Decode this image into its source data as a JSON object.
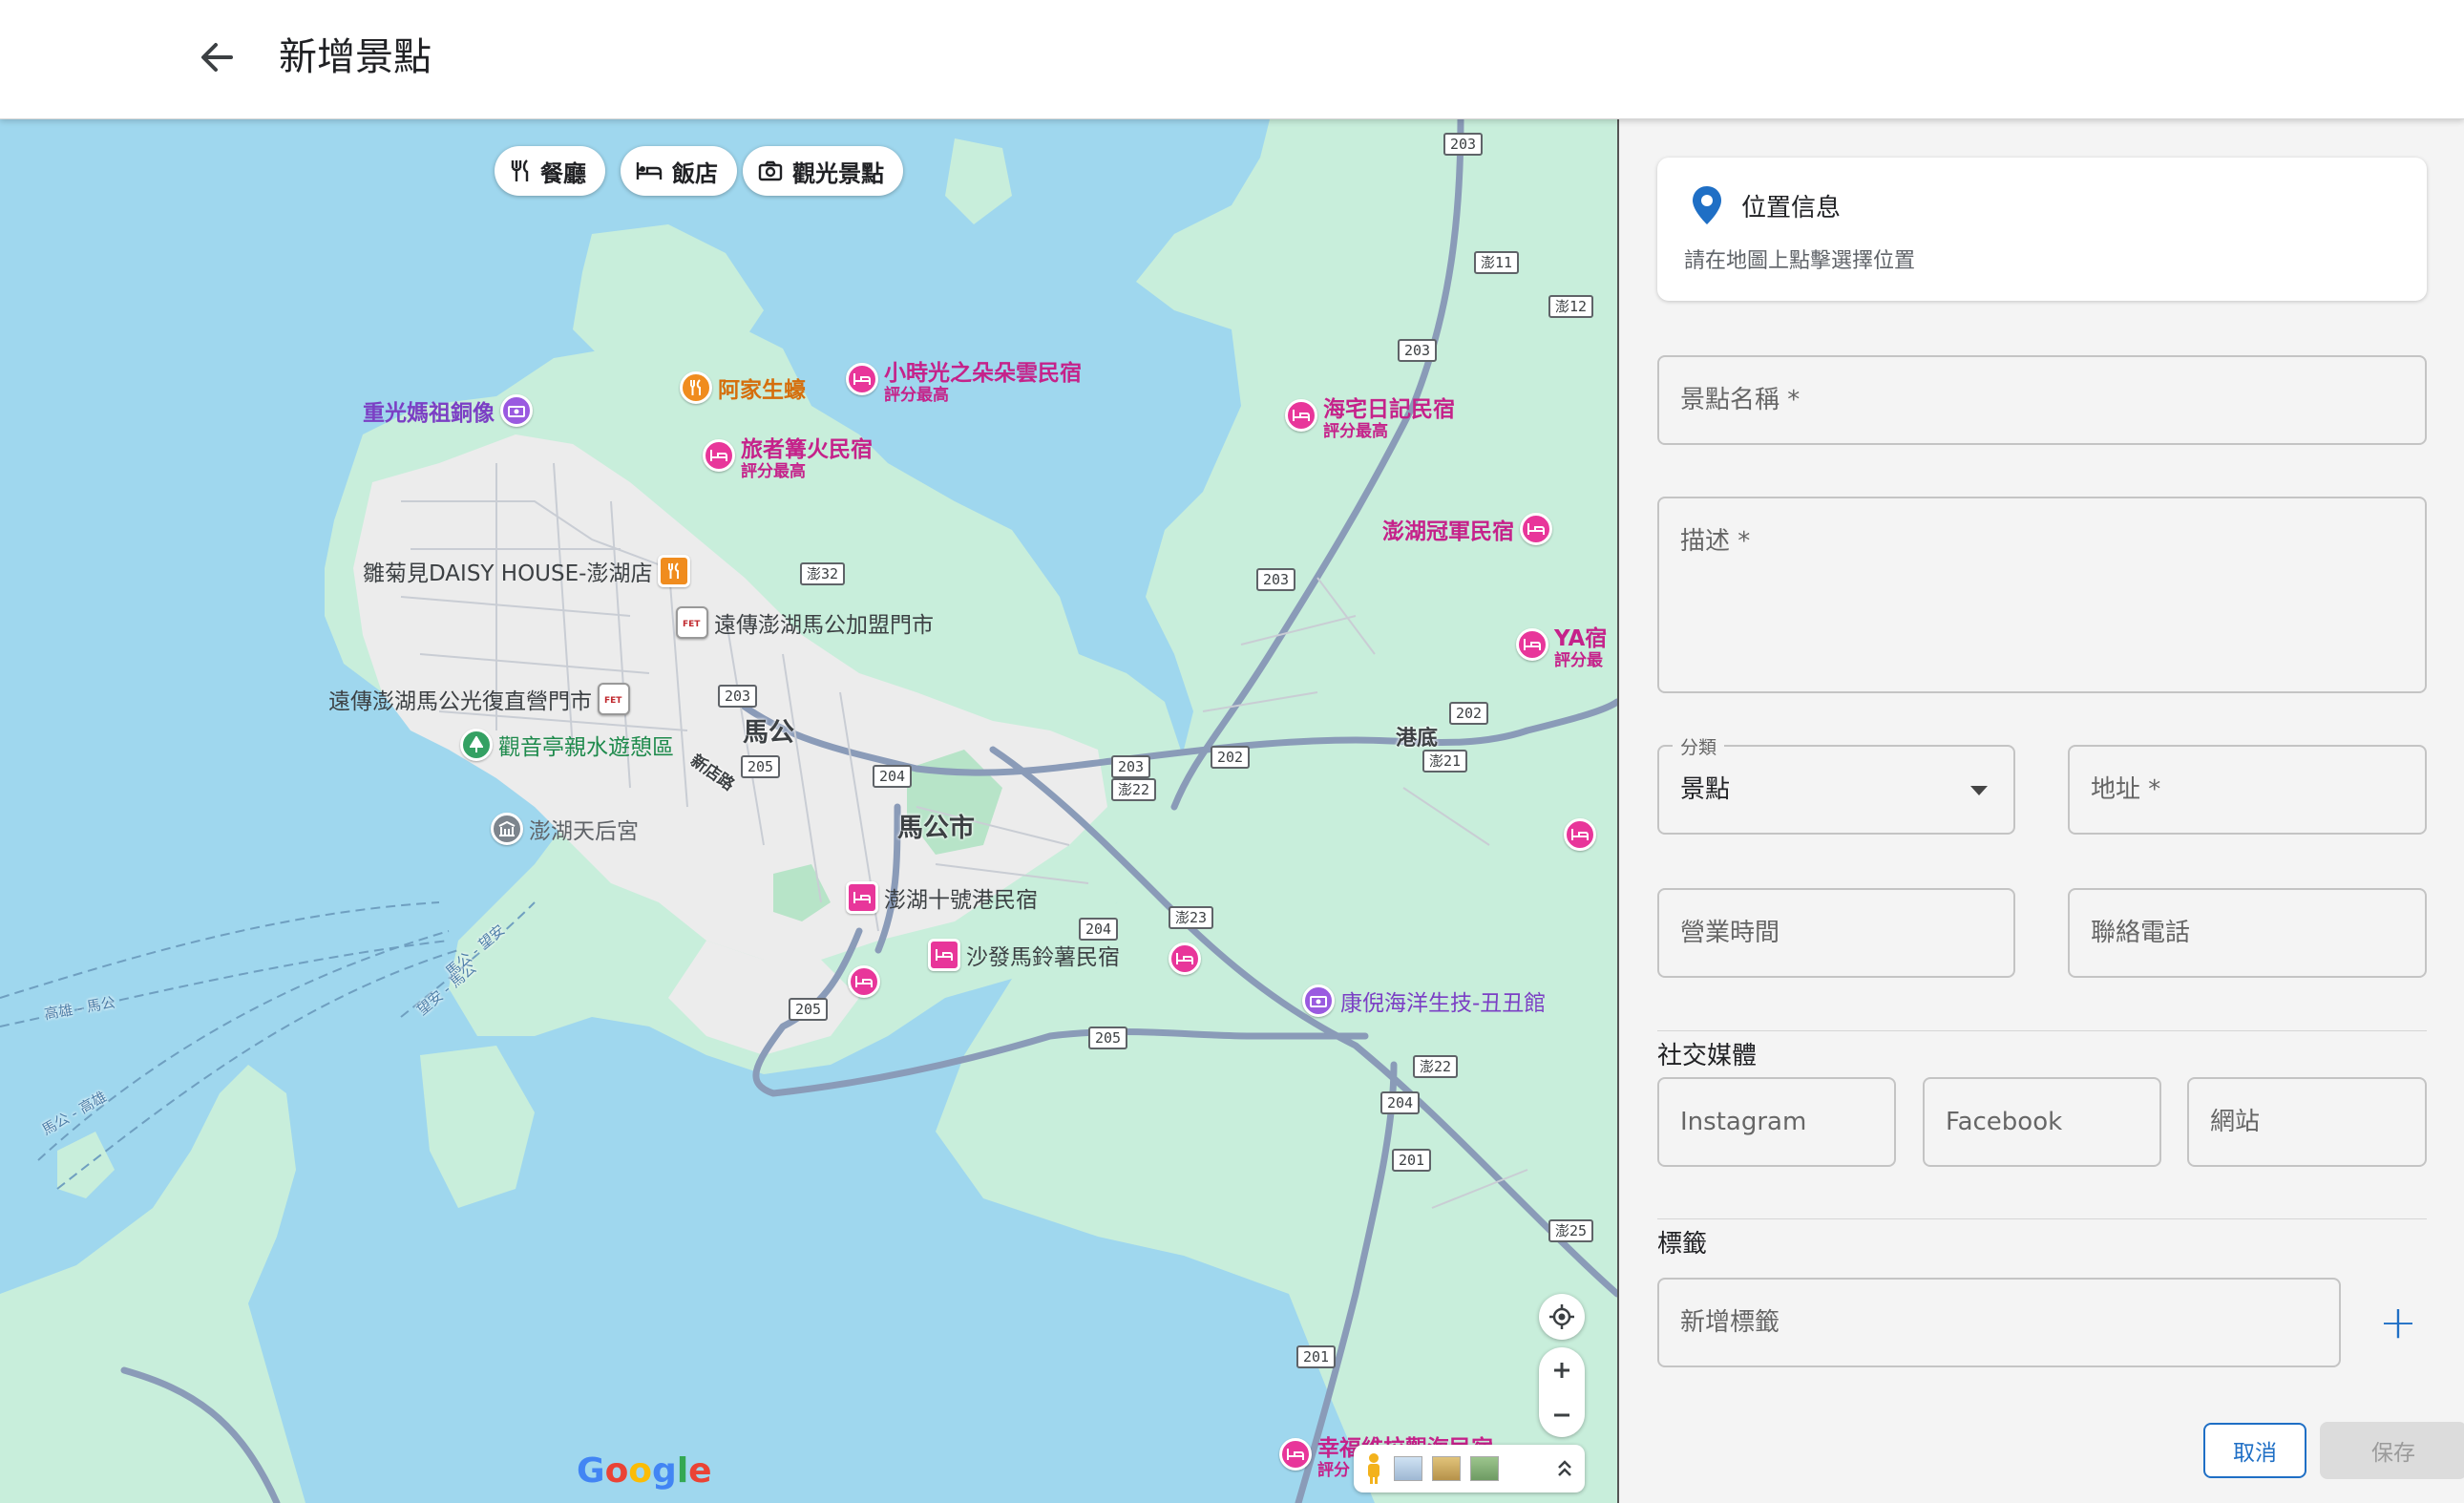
{
  "header": {
    "title": "新增景點"
  },
  "map": {
    "chips": [
      {
        "label": "餐廳",
        "icon": "fork-knife-icon"
      },
      {
        "label": "飯店",
        "icon": "bed-icon"
      },
      {
        "label": "觀光景點",
        "icon": "camera-icon"
      }
    ],
    "pois": {
      "p1": "小時光之朵朵雲民宿",
      "p1s": "評分最高",
      "p2": "阿家生蠔",
      "p3": "重光媽祖銅像",
      "p4": "旅者篝火民宿",
      "p4s": "評分最高",
      "p5": "海宅日記民宿",
      "p5s": "評分最高",
      "p6": "澎湖冠軍民宿",
      "p7": "雛菊見DAISY HOUSE-澎湖店",
      "p8": "遠傳澎湖馬公加盟門市",
      "p9": "YA宿",
      "p9s": "評分最",
      "p10": "遠傳澎湖馬公光復直營門市",
      "p11": "觀音亭親水遊憩區",
      "p12": "澎湖天后宮",
      "p13": "澎湖十號港民宿",
      "p14": "沙發馬鈴薯民宿",
      "p15": "康倪海洋生技-丑丑館",
      "p16": "幸福維拉觀海民宿",
      "p16s": "評分"
    },
    "places": {
      "magong": "馬公",
      "magong_city": "馬公市",
      "gangdi": "港底",
      "xindian_rd": "新店路"
    },
    "shields": [
      "203",
      "澎11",
      "澎12",
      "203",
      "澎32",
      "203",
      "203",
      "202",
      "202",
      "澎21",
      "205",
      "204",
      "203",
      "澎22",
      "202",
      "204",
      "澎23",
      "205",
      "205",
      "澎22",
      "204",
      "201",
      "澎25",
      "201"
    ],
    "ferry_routes": [
      "高雄 - 馬公",
      "馬公 - 高雄",
      "望安 - 馬公",
      "馬公 - 望安"
    ],
    "google_logo": "Google",
    "colors": {
      "water": "#9fd7ee",
      "land": "#c8eedb",
      "urban": "#eeeeee",
      "road": "#8a9bb8"
    }
  },
  "form": {
    "location": {
      "title": "位置信息",
      "hint": "請在地圖上點擊選擇位置"
    },
    "name_placeholder": "景點名稱 *",
    "desc_placeholder": "描述 *",
    "category": {
      "label": "分類",
      "value": "景點"
    },
    "address_placeholder": "地址 *",
    "hours_placeholder": "營業時間",
    "phone_placeholder": "聯絡電話",
    "social_title": "社交媒體",
    "instagram_placeholder": "Instagram",
    "facebook_placeholder": "Facebook",
    "website_placeholder": "網站",
    "tags_title": "標籤",
    "tag_placeholder": "新增標籤",
    "add_symbol": "+",
    "cancel_label": "取消",
    "save_label": "保存"
  }
}
